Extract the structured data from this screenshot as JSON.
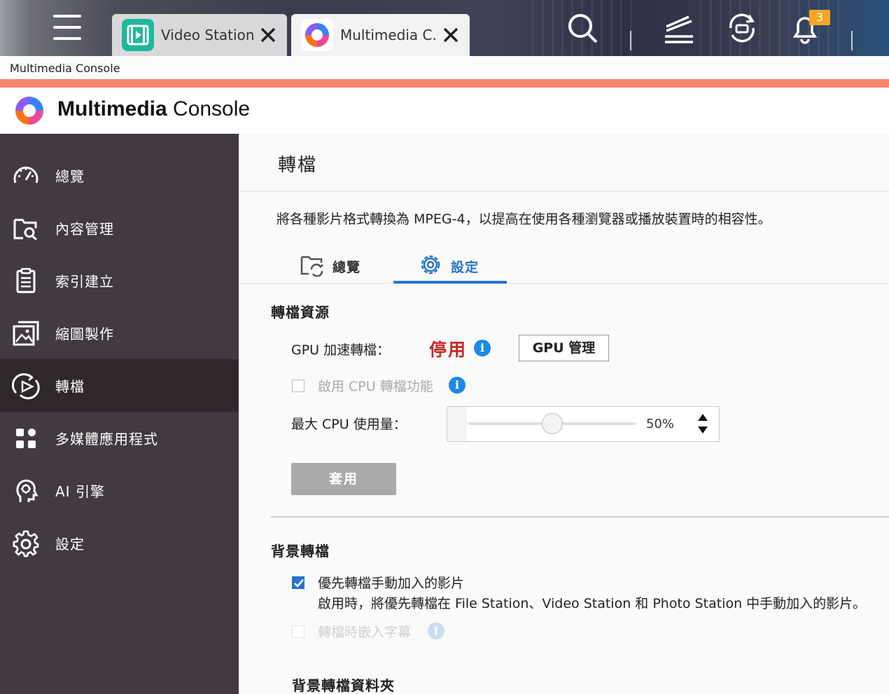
{
  "taskbar": {
    "tabs": [
      {
        "title": "Video Station ...",
        "icon": "video-station-icon"
      },
      {
        "title": "Multimedia C...",
        "icon": "multimedia-console-icon"
      }
    ],
    "notification_count": "3",
    "icons": [
      "menu-icon",
      "search-icon",
      "task-stack-icon",
      "sync-icon",
      "bell-icon"
    ]
  },
  "window": {
    "title": "Multimedia Console"
  },
  "app": {
    "name_bold": "Multimedia",
    "name_rest": " Console"
  },
  "sidebar": {
    "items": [
      {
        "label": "總覽",
        "icon": "gauge-icon"
      },
      {
        "label": "內容管理",
        "icon": "folder-search-icon"
      },
      {
        "label": "索引建立",
        "icon": "clipboard-icon"
      },
      {
        "label": "縮圖製作",
        "icon": "image-gallery-icon"
      },
      {
        "label": "轉檔",
        "icon": "transcode-icon",
        "active": true
      },
      {
        "label": "多媒體應用程式",
        "icon": "app-grid-icon"
      },
      {
        "label": "AI 引擎",
        "icon": "ai-head-icon"
      },
      {
        "label": "設定",
        "icon": "gear-icon"
      }
    ]
  },
  "main": {
    "title": "轉檔",
    "description": "將各種影片格式轉換為 MPEG-4，以提高在使用各種瀏覽器或播放裝置時的相容性。",
    "tabs": [
      {
        "label": "總覽",
        "icon": "folder-sync-icon"
      },
      {
        "label": "設定",
        "icon": "gear-icon",
        "active": true
      }
    ],
    "resources": {
      "heading": "轉檔資源",
      "gpu_label": "GPU 加速轉檔：",
      "gpu_status": "停用",
      "gpu_button": "GPU 管理",
      "cpu_enable_label": "啟用 CPU 轉檔功能",
      "cpu_enable_checked": false,
      "max_cpu_label": "最大 CPU 使用量：",
      "max_cpu_value": "50%",
      "max_cpu_fraction": 0.5,
      "apply_button": "套用"
    },
    "background": {
      "heading": "背景轉檔",
      "priority_label": "優先轉檔手動加入的影片",
      "priority_checked": true,
      "priority_desc": "啟用時，將優先轉檔在 File Station、Video Station 和 Photo Station 中手動加入的影片。",
      "subtitle_label": "轉檔時嵌入字幕",
      "subtitle_checked": false,
      "folder_heading": "背景轉檔資料夾"
    },
    "info_glyph": "i"
  },
  "colors": {
    "accent": "#2773cc",
    "sidebar_bg": "#433941",
    "sidebar_active": "#2f272c",
    "orange_bar": "#f4866a",
    "status_red": "#c62828"
  }
}
